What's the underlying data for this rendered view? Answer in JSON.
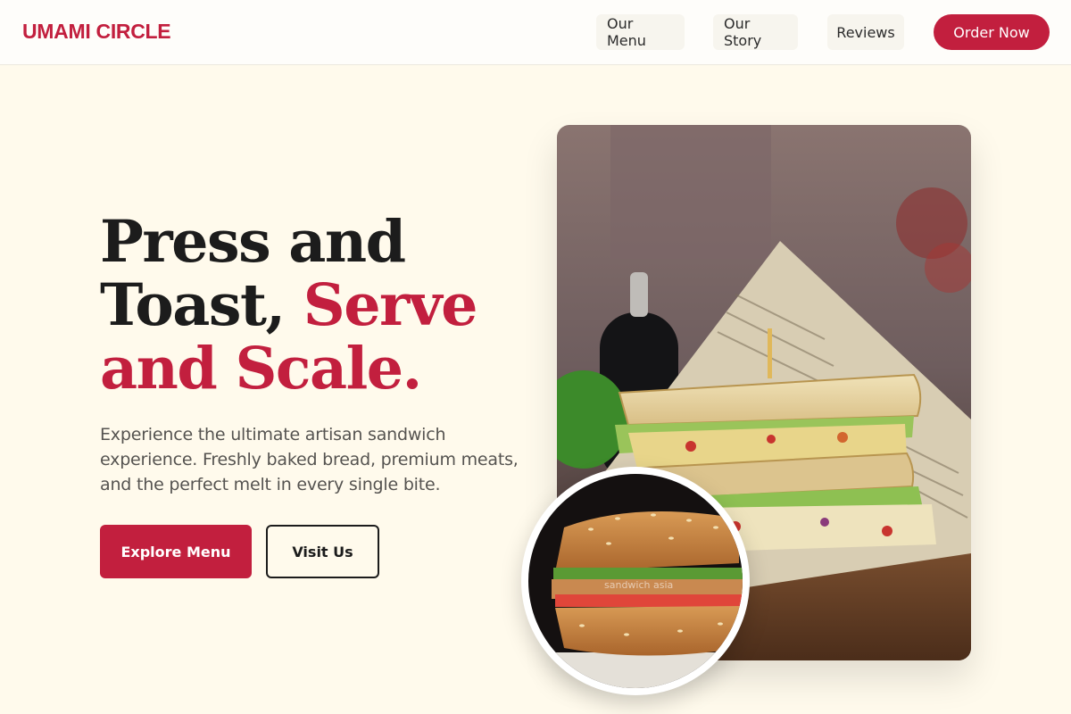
{
  "brand": {
    "name": "UMAMI CIRCLE",
    "color": "#c21f3e"
  },
  "nav": {
    "items": [
      {
        "label": "Our Menu"
      },
      {
        "label": "Our Story"
      },
      {
        "label": "Reviews"
      }
    ],
    "cta": "Order Now"
  },
  "hero": {
    "headline_line1": "Press and",
    "headline_line2_dark": "Toast, ",
    "headline_line2_accent": "Serve",
    "headline_line3_accent": "and Scale.",
    "subtitle": "Experience the ultimate artisan sandwich experience. Freshly baked bread, premium meats, and the perfect melt in every single bite.",
    "primary_button": "Explore Menu",
    "secondary_button": "Visit Us"
  },
  "images": {
    "main": "club-sandwich-on-newspaper-photo",
    "inset": "sesame-toasted-sandwich-photo",
    "inset_watermark": "sandwich asia"
  },
  "colors": {
    "background": "#fffaec",
    "accent": "#c21f3e",
    "text": "#1c1c1c"
  }
}
